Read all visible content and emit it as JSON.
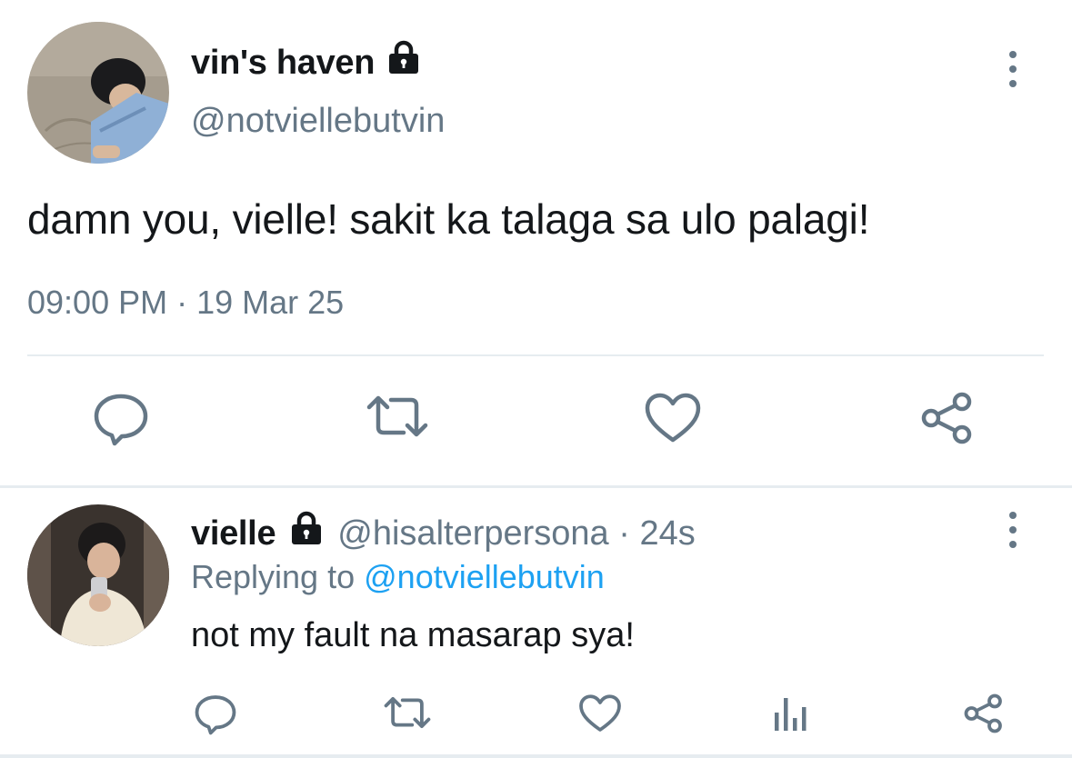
{
  "main_tweet": {
    "display_name": "vin's haven",
    "handle": "@notviellebutvin",
    "text": "damn you, vielle! sakit ka talaga sa ulo palagi!",
    "timestamp": "09:00 PM · 19 Mar 25",
    "icons": {
      "protected": "lock-icon",
      "more": "more-vertical-icon",
      "reply": "reply-icon",
      "retweet": "retweet-icon",
      "like": "heart-icon",
      "share": "share-icon"
    }
  },
  "reply_tweet": {
    "display_name": "vielle",
    "handle_time": "@hisalterpersona · 24s",
    "replying_prefix": "Replying to",
    "replying_handle": "@notviellebutvin",
    "text": "not my fault na masarap sya!",
    "icons": {
      "protected": "lock-icon",
      "more": "more-vertical-icon",
      "reply": "reply-icon",
      "retweet": "retweet-icon",
      "like": "heart-icon",
      "analytics": "bar-chart-icon",
      "share": "share-icon"
    }
  },
  "colors": {
    "text_primary": "#14171a",
    "text_secondary": "#657786",
    "link": "#1da1f2",
    "divider": "#e6ecf0"
  }
}
